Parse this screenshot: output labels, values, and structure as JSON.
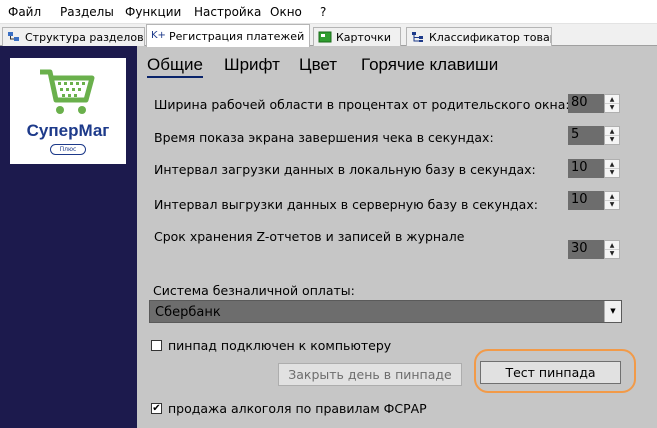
{
  "menubar": {
    "items": [
      "Файл",
      "Разделы",
      "Функции",
      "Настройка",
      "Окно",
      "?"
    ]
  },
  "tabs": [
    {
      "label": "Структура разделов",
      "icon": "structure-icon",
      "active": false
    },
    {
      "label": "Регистрация платежей",
      "icon": "kplus-icon",
      "icon_text": "K+",
      "active": true
    },
    {
      "label": "Карточки",
      "icon": "cards-icon",
      "active": false
    },
    {
      "label": "Классификатор товаров",
      "icon": "classifier-icon",
      "active": false
    }
  ],
  "logo": {
    "brand": "СуперМаг",
    "sub": "Плюс",
    "icon": "shopping-cart-icon",
    "cart_color": "#6ab04c",
    "brand_color": "#1d3a8a"
  },
  "subtabs": [
    "Общие",
    "Шрифт",
    "Цвет",
    "Горячие клавиши"
  ],
  "settings": [
    {
      "label": "Ширина рабочей области в процентах от родительского окна:",
      "value": "80"
    },
    {
      "label": "Время показа экрана завершения чека в секундах:",
      "value": "5"
    },
    {
      "label": "Интервал загрузки данных в локальную базу в секундах:",
      "value": "10"
    },
    {
      "label": "Интервал выгрузки данных в серверную базу в секундах:",
      "value": "10"
    },
    {
      "label": "Срок хранения Z-отчетов и записей в журнале",
      "value": "30"
    }
  ],
  "payment": {
    "label": "Система безналичной оплаты:",
    "selected": "Сбербанк"
  },
  "pinpad_checkbox": {
    "label": "пинпад подключен к компьютеру",
    "checked": false,
    "mark": ""
  },
  "buttons": {
    "close_day": "Закрыть день в пинпаде",
    "test_pinpad": "Тест пинпада"
  },
  "alcohol_checkbox": {
    "label": "продажа алкоголя по правилам ФСРАР",
    "checked": true,
    "mark": "✔"
  },
  "colors": {
    "sidebar": "#1c1a4d",
    "panel": "#c6c6c6",
    "field": "#6d6d6d",
    "highlight": "#f29a48"
  }
}
